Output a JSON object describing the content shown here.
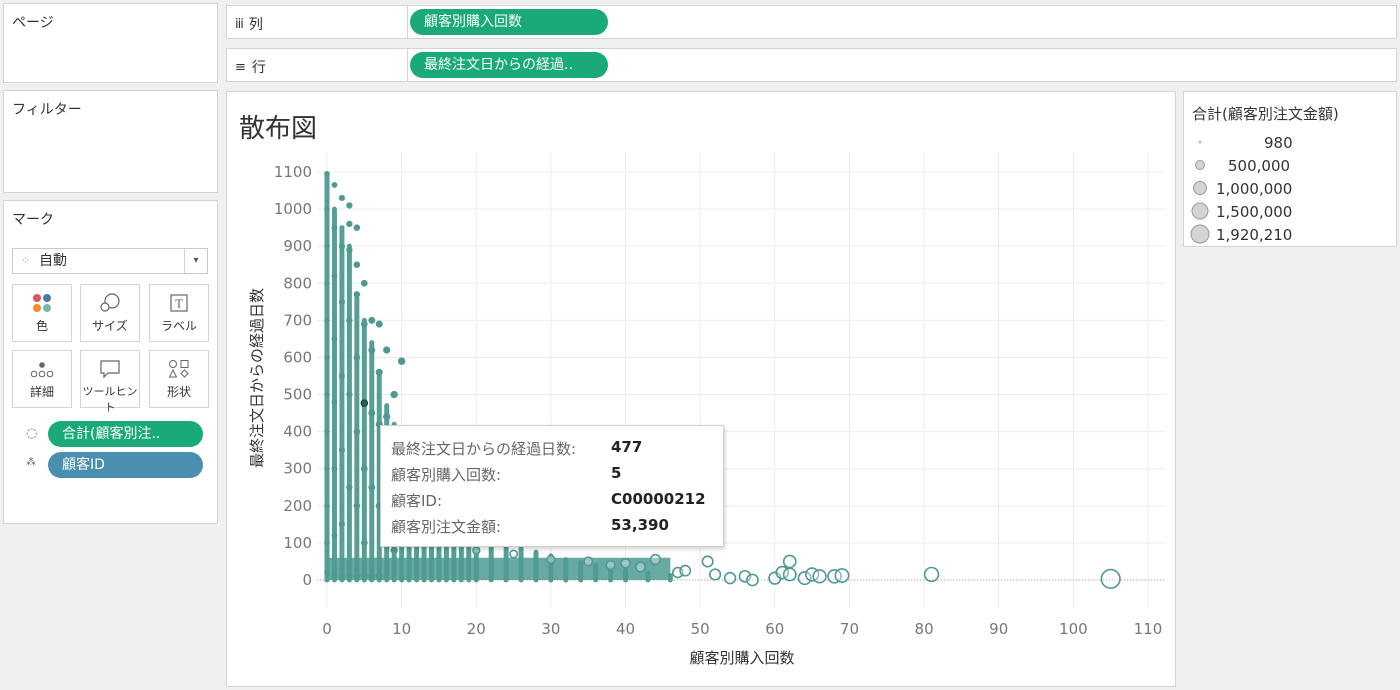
{
  "pages_panel": {
    "title": "ページ"
  },
  "filters_panel": {
    "title": "フィルター"
  },
  "marks_panel": {
    "title": "マーク",
    "mark_type": "自動",
    "buttons": {
      "color": "色",
      "size": "サイズ",
      "label": "ラベル",
      "detail": "詳細",
      "tooltip": "ツールヒント",
      "shape": "形状"
    },
    "fields": [
      {
        "label": "合計(顧客別注..",
        "color": "#1aaa78"
      },
      {
        "label": "顧客ID",
        "color": "#4a8fb0"
      }
    ]
  },
  "shelves": {
    "columns": {
      "label": "列",
      "pill": "顧客別購入回数"
    },
    "rows": {
      "label": "行",
      "pill": "最終注文日からの経過.."
    }
  },
  "legend": {
    "title": "合計(顧客別注文金額)",
    "items": [
      {
        "label": "980",
        "value": 980
      },
      {
        "label": "500,000",
        "value": 500000
      },
      {
        "label": "1,000,000",
        "value": 1000000
      },
      {
        "label": "1,500,000",
        "value": 1500000
      },
      {
        "label": "1,920,210",
        "value": 1920210
      }
    ]
  },
  "tooltip": {
    "rows": [
      {
        "key": "最終注文日からの経過日数:",
        "value": "477"
      },
      {
        "key": "顧客別購入回数:",
        "value": "5"
      },
      {
        "key": "顧客ID:",
        "value": "C00000212"
      },
      {
        "key": "顧客別注文金額:",
        "value": "53,390"
      }
    ]
  },
  "colors": {
    "mark": "#4e9a92",
    "accent_green": "#1aaa78",
    "accent_blue": "#4a8fb0"
  },
  "chart_data": {
    "type": "scatter",
    "title": "散布図",
    "xlabel": "顧客別購入回数",
    "ylabel": "最終注文日からの経過日数",
    "xlim": [
      0,
      110
    ],
    "ylim": [
      0,
      1100
    ],
    "xticks": [
      0,
      10,
      20,
      30,
      40,
      50,
      60,
      70,
      80,
      90,
      100,
      110
    ],
    "yticks": [
      0,
      100,
      200,
      300,
      400,
      500,
      600,
      700,
      800,
      900,
      1000,
      1100
    ],
    "grid": true,
    "size_field": "合計(顧客別注文金額)",
    "points": [
      {
        "x": 0,
        "y": 1095,
        "size": 2000
      },
      {
        "x": 0,
        "y": 1000,
        "size": 2000
      },
      {
        "x": 0,
        "y": 900,
        "size": 2000
      },
      {
        "x": 0,
        "y": 800,
        "size": 2000
      },
      {
        "x": 0,
        "y": 700,
        "size": 2000
      },
      {
        "x": 0,
        "y": 600,
        "size": 2000
      },
      {
        "x": 0,
        "y": 500,
        "size": 2000
      },
      {
        "x": 0,
        "y": 400,
        "size": 2000
      },
      {
        "x": 0,
        "y": 300,
        "size": 2000
      },
      {
        "x": 0,
        "y": 200,
        "size": 2000
      },
      {
        "x": 0,
        "y": 100,
        "size": 2000
      },
      {
        "x": 0,
        "y": 20,
        "size": 2000
      },
      {
        "x": 1,
        "y": 1065,
        "size": 4000
      },
      {
        "x": 1,
        "y": 950,
        "size": 4000
      },
      {
        "x": 1,
        "y": 820,
        "size": 4000
      },
      {
        "x": 1,
        "y": 650,
        "size": 4000
      },
      {
        "x": 1,
        "y": 480,
        "size": 4000
      },
      {
        "x": 1,
        "y": 300,
        "size": 4000
      },
      {
        "x": 1,
        "y": 120,
        "size": 4000
      },
      {
        "x": 1,
        "y": 10,
        "size": 4000
      },
      {
        "x": 2,
        "y": 1030,
        "size": 8000
      },
      {
        "x": 2,
        "y": 900,
        "size": 8000
      },
      {
        "x": 2,
        "y": 750,
        "size": 8000
      },
      {
        "x": 2,
        "y": 550,
        "size": 8000
      },
      {
        "x": 2,
        "y": 350,
        "size": 8000
      },
      {
        "x": 2,
        "y": 150,
        "size": 8000
      },
      {
        "x": 2,
        "y": 10,
        "size": 8000
      },
      {
        "x": 3,
        "y": 1010,
        "size": 12000
      },
      {
        "x": 3,
        "y": 960,
        "size": 12000
      },
      {
        "x": 3,
        "y": 890,
        "size": 12000
      },
      {
        "x": 3,
        "y": 700,
        "size": 12000
      },
      {
        "x": 3,
        "y": 500,
        "size": 12000
      },
      {
        "x": 3,
        "y": 250,
        "size": 12000
      },
      {
        "x": 3,
        "y": 10,
        "size": 12000
      },
      {
        "x": 4,
        "y": 950,
        "size": 15000
      },
      {
        "x": 4,
        "y": 850,
        "size": 15000
      },
      {
        "x": 4,
        "y": 770,
        "size": 15000
      },
      {
        "x": 4,
        "y": 600,
        "size": 15000
      },
      {
        "x": 4,
        "y": 400,
        "size": 15000
      },
      {
        "x": 4,
        "y": 200,
        "size": 15000
      },
      {
        "x": 4,
        "y": 10,
        "size": 15000
      },
      {
        "x": 5,
        "y": 800,
        "size": 20000
      },
      {
        "x": 5,
        "y": 690,
        "size": 20000
      },
      {
        "x": 5,
        "y": 477,
        "size": 53390
      },
      {
        "x": 5,
        "y": 300,
        "size": 20000
      },
      {
        "x": 5,
        "y": 100,
        "size": 20000
      },
      {
        "x": 5,
        "y": 10,
        "size": 20000
      },
      {
        "x": 6,
        "y": 700,
        "size": 25000
      },
      {
        "x": 6,
        "y": 620,
        "size": 25000
      },
      {
        "x": 6,
        "y": 450,
        "size": 25000
      },
      {
        "x": 6,
        "y": 250,
        "size": 25000
      },
      {
        "x": 6,
        "y": 10,
        "size": 25000
      },
      {
        "x": 7,
        "y": 690,
        "size": 30000
      },
      {
        "x": 7,
        "y": 560,
        "size": 30000
      },
      {
        "x": 7,
        "y": 420,
        "size": 30000
      },
      {
        "x": 7,
        "y": 200,
        "size": 30000
      },
      {
        "x": 7,
        "y": 10,
        "size": 30000
      },
      {
        "x": 8,
        "y": 620,
        "size": 35000
      },
      {
        "x": 8,
        "y": 440,
        "size": 35000
      },
      {
        "x": 8,
        "y": 150,
        "size": 35000
      },
      {
        "x": 9,
        "y": 500,
        "size": 40000
      },
      {
        "x": 9,
        "y": 300,
        "size": 40000
      },
      {
        "x": 9,
        "y": 80,
        "size": 40000
      },
      {
        "x": 10,
        "y": 590,
        "size": 45000
      },
      {
        "x": 10,
        "y": 390,
        "size": 45000
      },
      {
        "x": 10,
        "y": 100,
        "size": 45000
      },
      {
        "x": 15,
        "y": 110,
        "size": 70000
      },
      {
        "x": 20,
        "y": 80,
        "size": 90000
      },
      {
        "x": 25,
        "y": 70,
        "size": 120000
      },
      {
        "x": 30,
        "y": 55,
        "size": 150000
      },
      {
        "x": 35,
        "y": 50,
        "size": 200000
      },
      {
        "x": 38,
        "y": 40,
        "size": 220000
      },
      {
        "x": 40,
        "y": 45,
        "size": 250000
      },
      {
        "x": 42,
        "y": 35,
        "size": 300000
      },
      {
        "x": 44,
        "y": 55,
        "size": 330000
      },
      {
        "x": 47,
        "y": 20,
        "size": 350000
      },
      {
        "x": 48,
        "y": 25,
        "size": 380000
      },
      {
        "x": 51,
        "y": 50,
        "size": 400000
      },
      {
        "x": 52,
        "y": 15,
        "size": 420000
      },
      {
        "x": 54,
        "y": 5,
        "size": 450000
      },
      {
        "x": 56,
        "y": 10,
        "size": 480000
      },
      {
        "x": 57,
        "y": 0,
        "size": 500000
      },
      {
        "x": 60,
        "y": 5,
        "size": 550000
      },
      {
        "x": 61,
        "y": 20,
        "size": 600000
      },
      {
        "x": 62,
        "y": 50,
        "size": 620000
      },
      {
        "x": 62,
        "y": 15,
        "size": 640000
      },
      {
        "x": 64,
        "y": 5,
        "size": 660000
      },
      {
        "x": 65,
        "y": 15,
        "size": 700000
      },
      {
        "x": 66,
        "y": 10,
        "size": 720000
      },
      {
        "x": 68,
        "y": 10,
        "size": 760000
      },
      {
        "x": 69,
        "y": 12,
        "size": 800000
      },
      {
        "x": 81,
        "y": 15,
        "size": 900000
      },
      {
        "x": 105,
        "y": 3,
        "size": 1920210
      }
    ],
    "density_columns": [
      {
        "x": 0,
        "top": 1095
      },
      {
        "x": 1,
        "top": 1000
      },
      {
        "x": 2,
        "top": 950
      },
      {
        "x": 3,
        "top": 900
      },
      {
        "x": 4,
        "top": 760
      },
      {
        "x": 5,
        "top": 700
      },
      {
        "x": 6,
        "top": 640
      },
      {
        "x": 7,
        "top": 560
      },
      {
        "x": 8,
        "top": 470
      },
      {
        "x": 9,
        "top": 420
      },
      {
        "x": 10,
        "top": 380
      },
      {
        "x": 11,
        "top": 340
      },
      {
        "x": 12,
        "top": 300
      },
      {
        "x": 13,
        "top": 260
      },
      {
        "x": 14,
        "top": 230
      },
      {
        "x": 15,
        "top": 200
      },
      {
        "x": 16,
        "top": 180
      },
      {
        "x": 17,
        "top": 160
      },
      {
        "x": 18,
        "top": 150
      },
      {
        "x": 19,
        "top": 140
      },
      {
        "x": 20,
        "top": 130
      },
      {
        "x": 22,
        "top": 110
      },
      {
        "x": 24,
        "top": 95
      },
      {
        "x": 26,
        "top": 85
      },
      {
        "x": 28,
        "top": 75
      },
      {
        "x": 30,
        "top": 65
      },
      {
        "x": 32,
        "top": 55
      },
      {
        "x": 34,
        "top": 48
      },
      {
        "x": 36,
        "top": 40
      },
      {
        "x": 38,
        "top": 32
      },
      {
        "x": 40,
        "top": 25
      },
      {
        "x": 43,
        "top": 18
      },
      {
        "x": 46,
        "top": 12
      }
    ]
  }
}
